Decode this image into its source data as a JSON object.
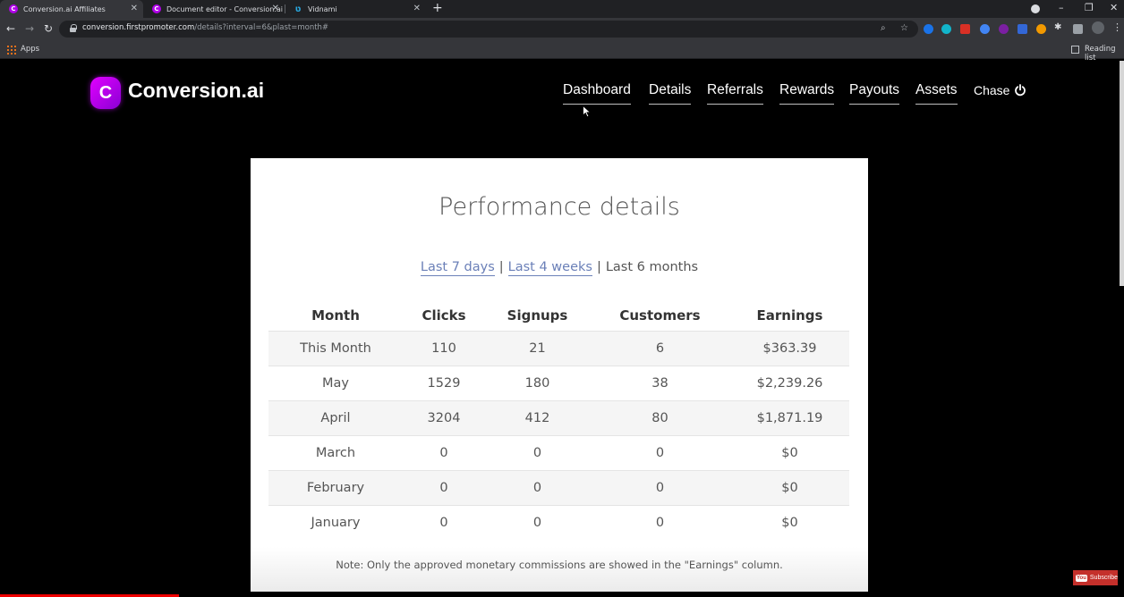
{
  "browser": {
    "tabs": [
      {
        "label": "Conversion.ai Affiliates",
        "favicon": "C"
      },
      {
        "label": "Document editor - Conversion.ai",
        "favicon": "C"
      },
      {
        "label": "Vidnami",
        "favicon": "vidnami-icon"
      }
    ],
    "url_host": "conversion.firstpromoter.com",
    "url_path": "/details?interval=6&plast=month#",
    "bookmarks_apps": "Apps",
    "reading_list": "Reading list"
  },
  "site": {
    "logo_letter": "C",
    "logo_text": "Conversion.ai",
    "nav": [
      "Dashboard",
      "Details",
      "Referrals",
      "Rewards",
      "Payouts",
      "Assets"
    ],
    "user_name": "Chase"
  },
  "card": {
    "title": "Performance details",
    "ranges": {
      "last_7_days": "Last 7 days",
      "last_4_weeks": "Last 4 weeks",
      "last_6_months": "Last 6 months",
      "separator": "|"
    },
    "columns": [
      "Month",
      "Clicks",
      "Signups",
      "Customers",
      "Earnings"
    ],
    "rows": [
      [
        "This Month",
        "110",
        "21",
        "6",
        "$363.39"
      ],
      [
        "May",
        "1529",
        "180",
        "38",
        "$2,239.26"
      ],
      [
        "April",
        "3204",
        "412",
        "80",
        "$1,871.19"
      ],
      [
        "March",
        "0",
        "0",
        "0",
        "$0"
      ],
      [
        "February",
        "0",
        "0",
        "0",
        "$0"
      ],
      [
        "January",
        "0",
        "0",
        "0",
        "$0"
      ]
    ],
    "note": "Note: Only the approved monetary commissions are showed in the \"Earnings\" column."
  },
  "overlay": {
    "subscribe_label": "Subscribe",
    "yt_label": "You"
  },
  "colors": {
    "brand": "#b000e8",
    "link": "#6b80b8",
    "background": "#000000"
  }
}
